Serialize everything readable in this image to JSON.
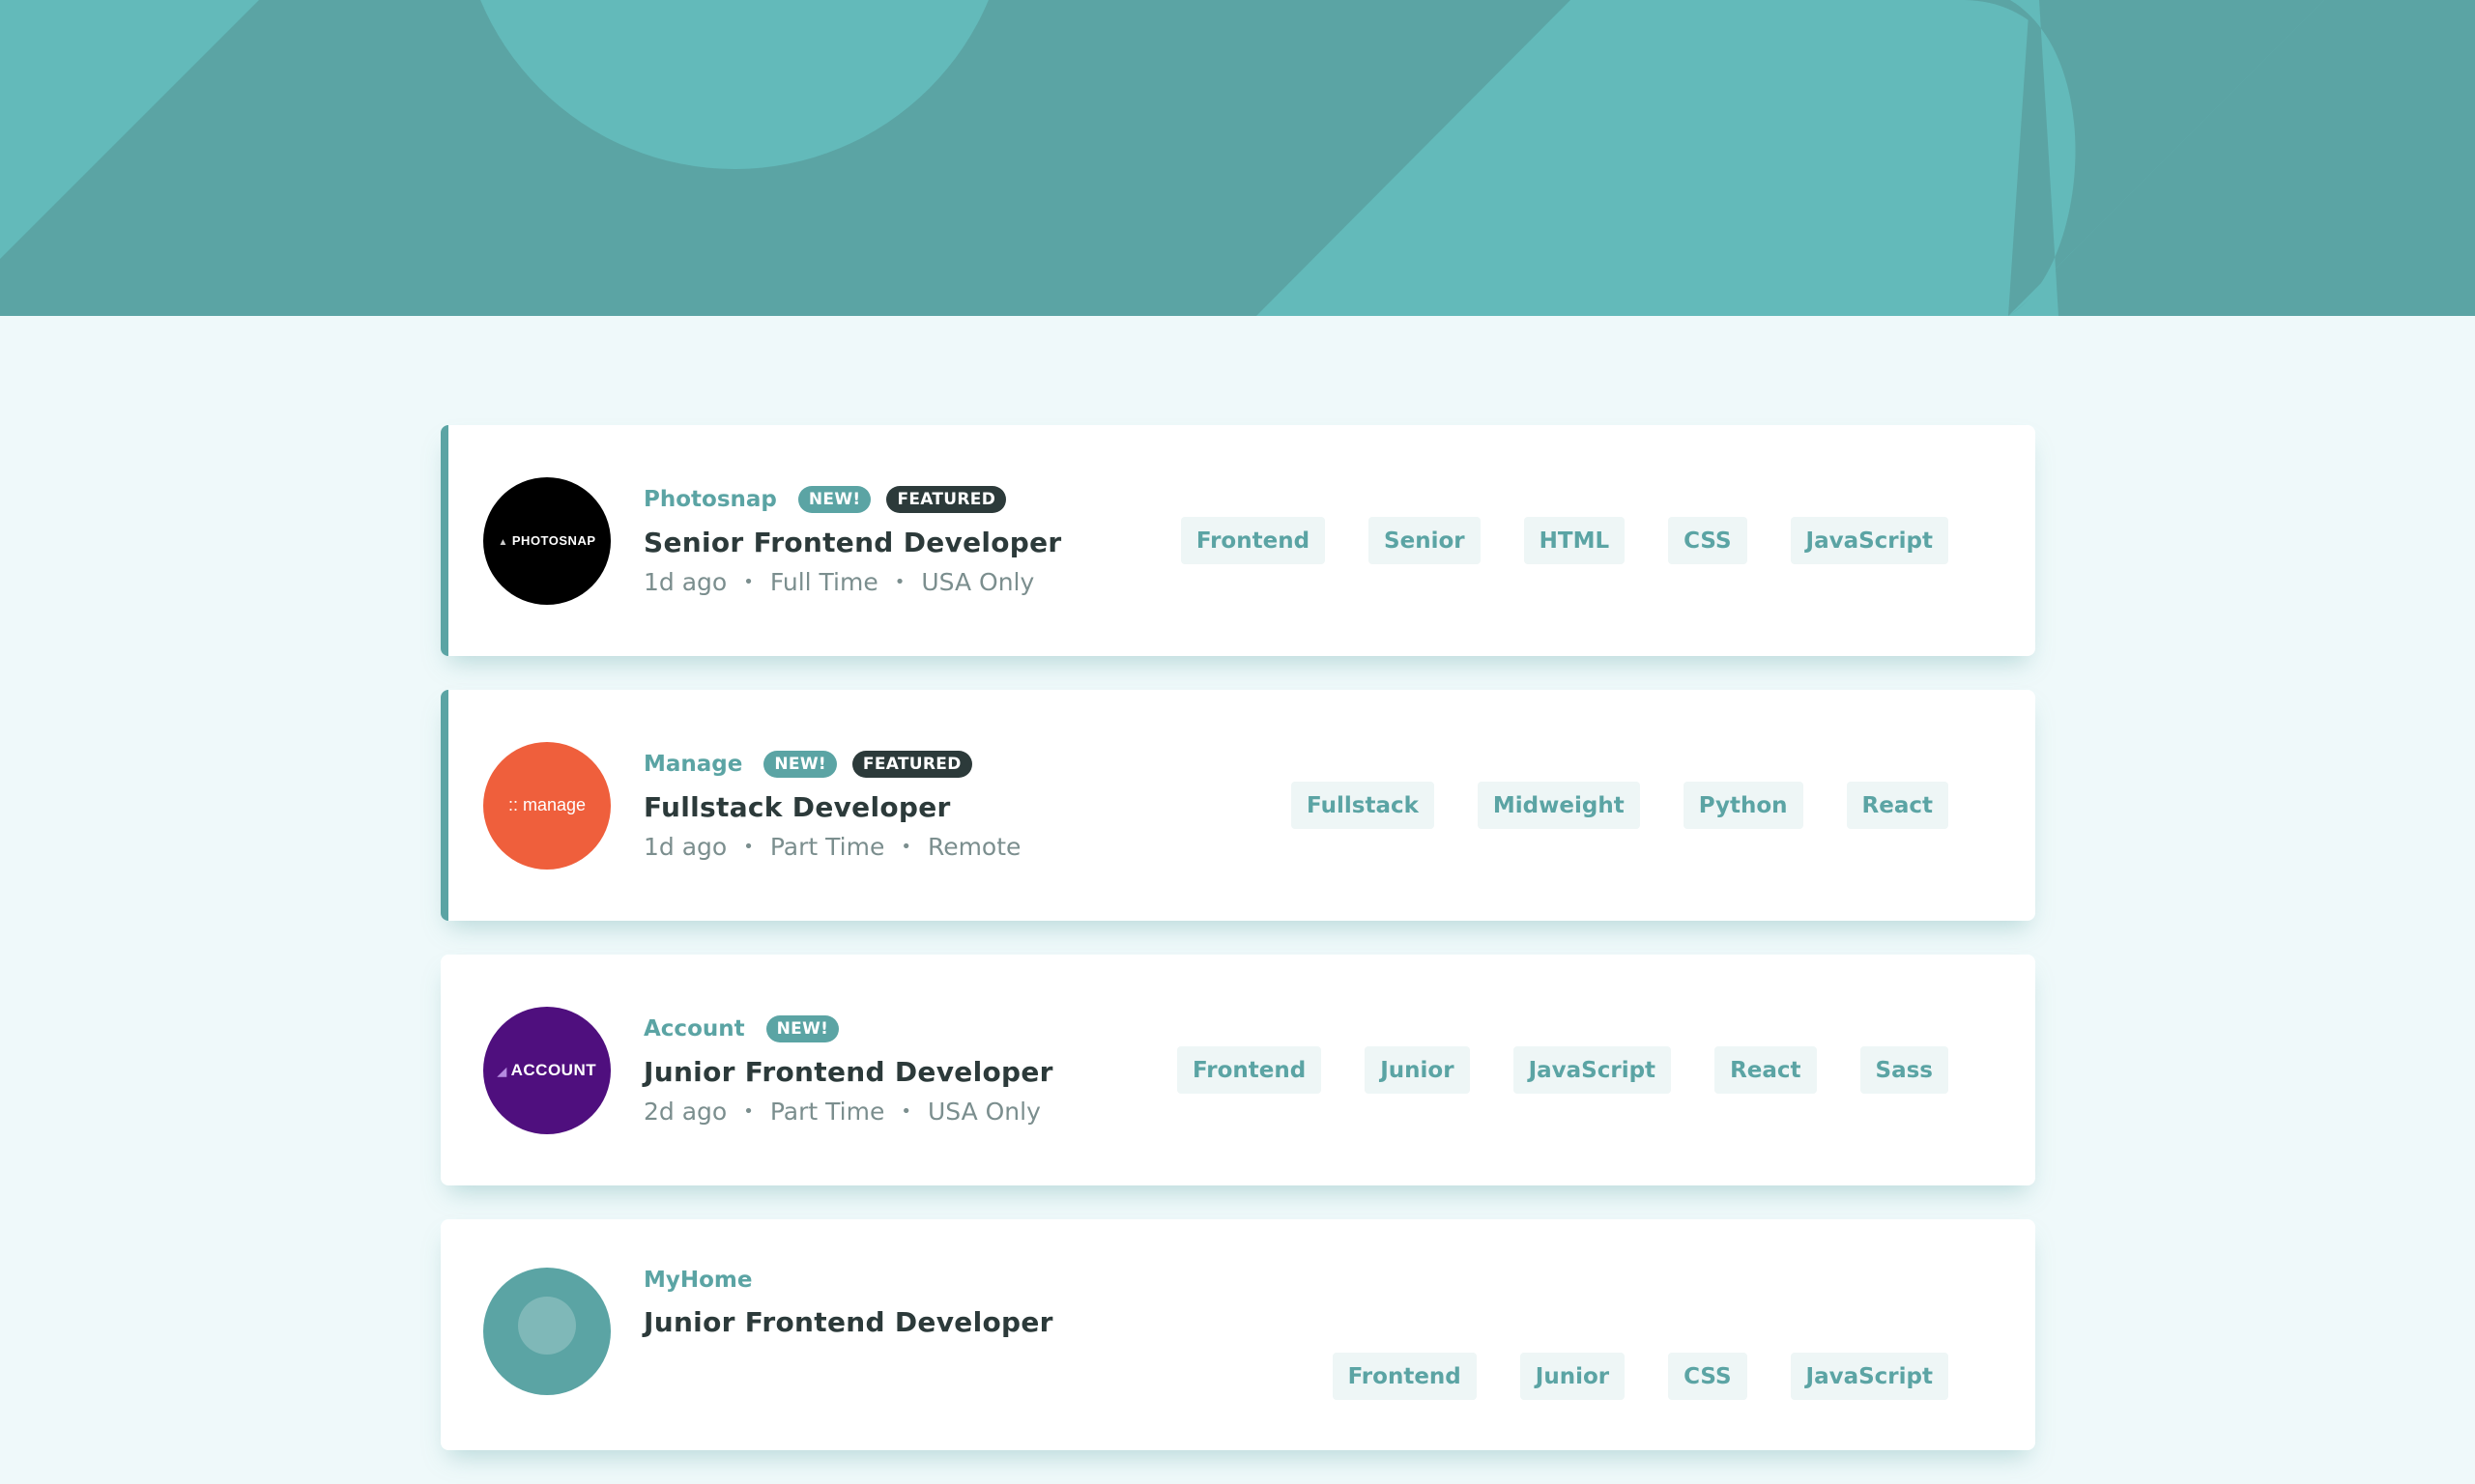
{
  "colors": {
    "primary": "#5ba4a4",
    "primary_light": "#63baba",
    "background": "#eff9fa",
    "tag_bg": "#eef6f6",
    "dark": "#2c3a3a",
    "gray": "#7b8e8e"
  },
  "jobs": [
    {
      "company": "Photosnap",
      "logo_text": "PHOTOSNAP",
      "logo_bg": "#000000",
      "new_label": "NEW!",
      "featured_label": "FEATURED",
      "position": "Senior Frontend Developer",
      "posted_at": "1d ago",
      "contract": "Full Time",
      "location": "USA Only",
      "tags": [
        "Frontend",
        "Senior",
        "HTML",
        "CSS",
        "JavaScript"
      ]
    },
    {
      "company": "Manage",
      "logo_text": ":: manage",
      "logo_bg": "#ef5f3c",
      "new_label": "NEW!",
      "featured_label": "FEATURED",
      "position": "Fullstack Developer",
      "posted_at": "1d ago",
      "contract": "Part Time",
      "location": "Remote",
      "tags": [
        "Fullstack",
        "Midweight",
        "Python",
        "React"
      ]
    },
    {
      "company": "Account",
      "logo_text": "ACCOUNT",
      "logo_bg": "#4f0f7e",
      "new_label": "NEW!",
      "position": "Junior Frontend Developer",
      "posted_at": "2d ago",
      "contract": "Part Time",
      "location": "USA Only",
      "tags": [
        "Frontend",
        "Junior",
        "JavaScript",
        "React",
        "Sass"
      ]
    },
    {
      "company": "MyHome",
      "logo_bg": "#5ba4a4",
      "position": "Junior Frontend Developer",
      "tags": [
        "Frontend",
        "Junior",
        "CSS",
        "JavaScript"
      ]
    }
  ]
}
